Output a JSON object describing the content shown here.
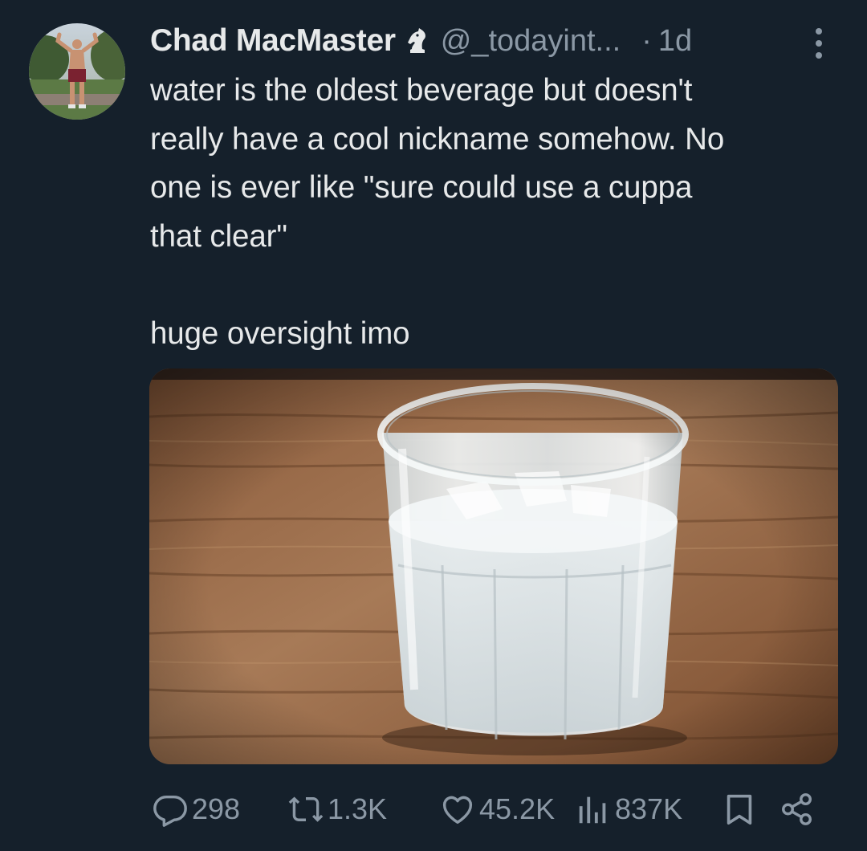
{
  "post": {
    "author": {
      "display_name": "Chad MacMaster",
      "handle": "@_todayint...",
      "badge_icon": "horse-chess-knight-icon"
    },
    "separator": "·",
    "timestamp": "1d",
    "text": "water is the oldest beverage but doesn't\nreally have a cool nickname somehow. No\none is ever like \"sure could use a cuppa\nthat clear\"\n\nhuge oversight imo",
    "media": {
      "kind": "photo",
      "subject": "glass-of-water-on-wooden-table"
    }
  },
  "actions": {
    "replies": "298",
    "reposts": "1.3K",
    "likes": "45.2K",
    "views": "837K",
    "bookmark_icon": "bookmark-icon",
    "share_icon": "share-icon"
  },
  "colors": {
    "background": "#15202b",
    "text_primary": "#e7e9ea",
    "text_secondary": "#8b98a5"
  }
}
